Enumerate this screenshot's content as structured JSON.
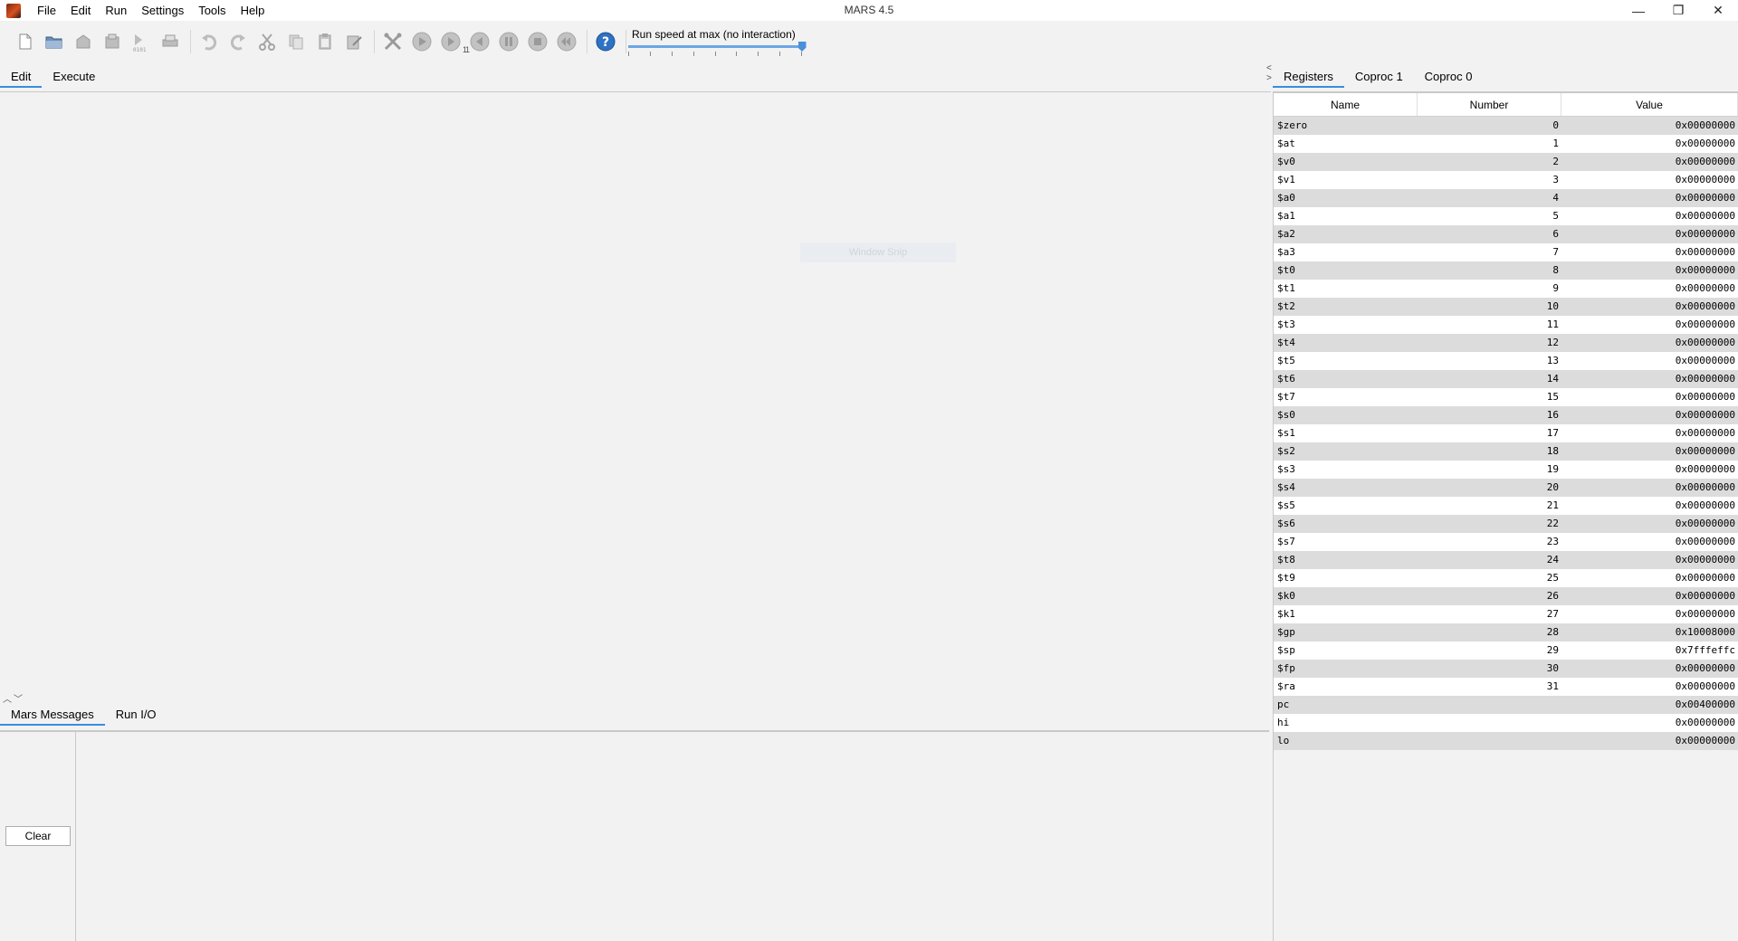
{
  "window": {
    "title": "MARS 4.5",
    "menu": [
      "File",
      "Edit",
      "Run",
      "Settings",
      "Tools",
      "Help"
    ],
    "controls": {
      "minimize": "—",
      "maximize": "❐",
      "close": "✕"
    }
  },
  "toolbar": {
    "icons": [
      "new-file-icon",
      "open-file-icon",
      "save-icon",
      "save-as-icon",
      "dump-memory-icon",
      "print-icon",
      "undo-icon",
      "redo-icon",
      "cut-icon",
      "copy-icon",
      "paste-icon",
      "find-replace-icon",
      "assemble-icon",
      "run-icon",
      "step-icon",
      "backstep-icon",
      "pause-icon",
      "stop-icon",
      "reset-icon",
      "help-icon"
    ],
    "step_badge": "1",
    "dump_badge": "0101",
    "speed_label": "Run speed at max (no interaction)",
    "speed_fraction": 1.0
  },
  "editor": {
    "tabs": [
      "Edit",
      "Execute"
    ],
    "active_tab": "Edit",
    "overlay": "Window Snip"
  },
  "messages": {
    "tabs": [
      "Mars Messages",
      "Run I/O"
    ],
    "active_tab": "Mars Messages",
    "clear_label": "Clear"
  },
  "registers": {
    "tabs": [
      "Registers",
      "Coproc 1",
      "Coproc 0"
    ],
    "active_tab": "Registers",
    "columns": [
      "Name",
      "Number",
      "Value"
    ],
    "rows": [
      [
        "$zero",
        "0",
        "0x00000000"
      ],
      [
        "$at",
        "1",
        "0x00000000"
      ],
      [
        "$v0",
        "2",
        "0x00000000"
      ],
      [
        "$v1",
        "3",
        "0x00000000"
      ],
      [
        "$a0",
        "4",
        "0x00000000"
      ],
      [
        "$a1",
        "5",
        "0x00000000"
      ],
      [
        "$a2",
        "6",
        "0x00000000"
      ],
      [
        "$a3",
        "7",
        "0x00000000"
      ],
      [
        "$t0",
        "8",
        "0x00000000"
      ],
      [
        "$t1",
        "9",
        "0x00000000"
      ],
      [
        "$t2",
        "10",
        "0x00000000"
      ],
      [
        "$t3",
        "11",
        "0x00000000"
      ],
      [
        "$t4",
        "12",
        "0x00000000"
      ],
      [
        "$t5",
        "13",
        "0x00000000"
      ],
      [
        "$t6",
        "14",
        "0x00000000"
      ],
      [
        "$t7",
        "15",
        "0x00000000"
      ],
      [
        "$s0",
        "16",
        "0x00000000"
      ],
      [
        "$s1",
        "17",
        "0x00000000"
      ],
      [
        "$s2",
        "18",
        "0x00000000"
      ],
      [
        "$s3",
        "19",
        "0x00000000"
      ],
      [
        "$s4",
        "20",
        "0x00000000"
      ],
      [
        "$s5",
        "21",
        "0x00000000"
      ],
      [
        "$s6",
        "22",
        "0x00000000"
      ],
      [
        "$s7",
        "23",
        "0x00000000"
      ],
      [
        "$t8",
        "24",
        "0x00000000"
      ],
      [
        "$t9",
        "25",
        "0x00000000"
      ],
      [
        "$k0",
        "26",
        "0x00000000"
      ],
      [
        "$k1",
        "27",
        "0x00000000"
      ],
      [
        "$gp",
        "28",
        "0x10008000"
      ],
      [
        "$sp",
        "29",
        "0x7fffeffc"
      ],
      [
        "$fp",
        "30",
        "0x00000000"
      ],
      [
        "$ra",
        "31",
        "0x00000000"
      ],
      [
        "pc",
        "",
        "0x00400000"
      ],
      [
        "hi",
        "",
        "0x00000000"
      ],
      [
        "lo",
        "",
        "0x00000000"
      ]
    ]
  }
}
